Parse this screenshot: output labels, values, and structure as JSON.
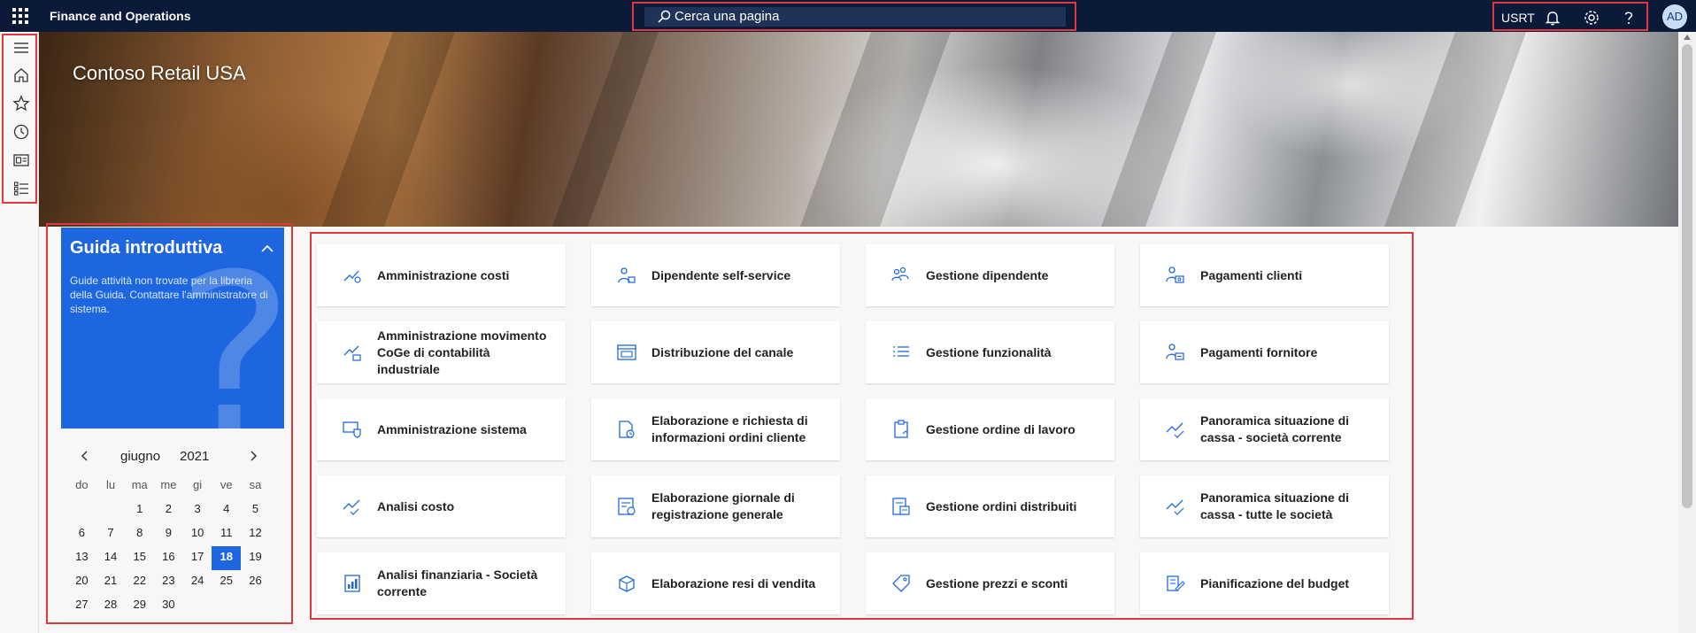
{
  "app": {
    "title": "Finance and Operations"
  },
  "search": {
    "placeholder": "Cerca una pagina"
  },
  "toolbar": {
    "company": "USRT"
  },
  "user": {
    "initials": "AD"
  },
  "banner": {
    "title": "Contoso Retail USA"
  },
  "leftnav": {
    "items": [
      "hamburger-icon",
      "home-icon",
      "star-icon",
      "clock-icon",
      "workspace-icon",
      "list-icon"
    ]
  },
  "guide": {
    "title": "Guida introduttiva",
    "text": "Guide attività non trovate per la libreria della Guida. Contattare l'amministratore di sistema.",
    "watermark": "?"
  },
  "calendar": {
    "month": "giugno",
    "year": "2021",
    "weekdays": [
      "do",
      "lu",
      "ma",
      "me",
      "gi",
      "ve",
      "sa"
    ],
    "weeks": [
      [
        "",
        "",
        "1",
        "2",
        "3",
        "4",
        "5"
      ],
      [
        "6",
        "7",
        "8",
        "9",
        "10",
        "11",
        "12"
      ],
      [
        "13",
        "14",
        "15",
        "16",
        "17",
        "18",
        "19"
      ],
      [
        "20",
        "21",
        "22",
        "23",
        "24",
        "25",
        "26"
      ],
      [
        "27",
        "28",
        "29",
        "30",
        "",
        "",
        ""
      ]
    ],
    "today": "18"
  },
  "tiles": [
    {
      "label": "Amministrazione costi",
      "icon": "cost-admin-icon"
    },
    {
      "label": "Dipendente self-service",
      "icon": "employee-self-service-icon"
    },
    {
      "label": "Gestione dipendente",
      "icon": "employee-management-icon"
    },
    {
      "label": "Pagamenti clienti",
      "icon": "customer-payments-icon"
    },
    {
      "label": "Amministrazione movimento CoGe di contabilità industriale",
      "icon": "ledger-admin-icon"
    },
    {
      "label": "Distribuzione del canale",
      "icon": "channel-distribution-icon"
    },
    {
      "label": "Gestione funzionalità",
      "icon": "feature-management-icon"
    },
    {
      "label": "Pagamenti fornitore",
      "icon": "vendor-payments-icon"
    },
    {
      "label": "Amministrazione sistema",
      "icon": "system-admin-icon"
    },
    {
      "label": "Elaborazione e richiesta di informazioni ordini cliente",
      "icon": "sales-order-icon"
    },
    {
      "label": "Gestione ordine di lavoro",
      "icon": "work-order-icon"
    },
    {
      "label": "Panoramica situazione di cassa - società corrente",
      "icon": "cash-overview-icon"
    },
    {
      "label": "Analisi costo",
      "icon": "cost-analysis-icon"
    },
    {
      "label": "Elaborazione giornale di registrazione generale",
      "icon": "general-journal-icon"
    },
    {
      "label": "Gestione ordini distribuiti",
      "icon": "distributed-orders-icon"
    },
    {
      "label": "Panoramica situazione di cassa - tutte le società",
      "icon": "cash-overview-all-icon"
    },
    {
      "label": "Analisi finanziaria - Società corrente",
      "icon": "financial-analysis-icon"
    },
    {
      "label": "Elaborazione resi di vendita",
      "icon": "sales-returns-icon"
    },
    {
      "label": "Gestione prezzi e sconti",
      "icon": "price-tag-icon"
    },
    {
      "label": "Pianificazione del budget",
      "icon": "budget-planning-icon"
    }
  ]
}
